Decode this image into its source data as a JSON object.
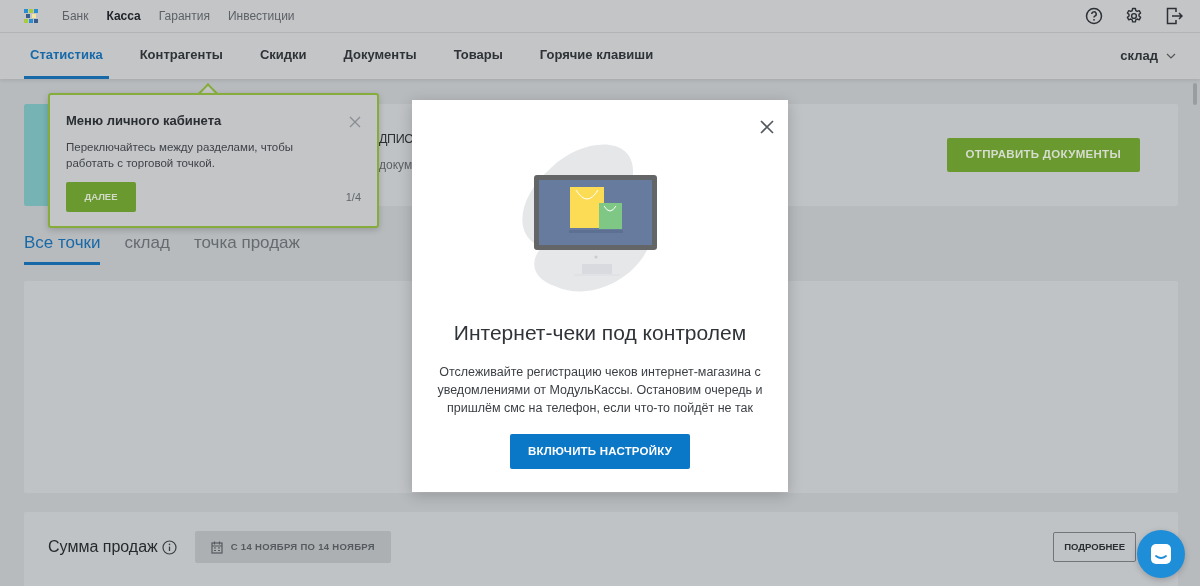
{
  "top_nav": {
    "items": [
      {
        "label": "Банк",
        "selected": false
      },
      {
        "label": "Касса",
        "selected": true
      },
      {
        "label": "Гарантия",
        "selected": false
      },
      {
        "label": "Инвестиции",
        "selected": false
      }
    ]
  },
  "section_tabs": [
    {
      "label": "Статистика",
      "selected": true
    },
    {
      "label": "Контрагенты",
      "selected": false
    },
    {
      "label": "Скидки",
      "selected": false
    },
    {
      "label": "Документы",
      "selected": false
    },
    {
      "label": "Товары",
      "selected": false
    },
    {
      "label": "Горячие клавиши",
      "selected": false
    }
  ],
  "store_selector": {
    "label": "склад"
  },
  "banner": {
    "title_fragment": "ДПИС",
    "text_fragment": "докум",
    "button": "ОТПРАВИТЬ ДОКУМЕНТЫ"
  },
  "point_tabs": [
    {
      "label": "Все точки",
      "selected": true
    },
    {
      "label": "склад",
      "selected": false
    },
    {
      "label": "точка продаж",
      "selected": false
    }
  ],
  "sales_card": {
    "title": "Сумма продаж",
    "date_range": "С 14 НОЯБРЯ ПО 14 НОЯБРЯ",
    "details_button": "ПОДРОБНЕЕ"
  },
  "tour_tooltip": {
    "title": "Меню личного кабинета",
    "text": "Переключайтесь между разделами, чтобы работать с торговой точкой.",
    "button": "ДАЛЕЕ",
    "step": "1/4"
  },
  "modal": {
    "title": "Интернет-чеки под контролем",
    "text": "Отслеживайте регистрацию чеков интернет-магазина с уведомлениями от МодульКассы. Остановим очередь и пришлём смс на телефон, если что-то пойдёт не так",
    "button": "ВКЛЮЧИТЬ НАСТРОЙКУ"
  }
}
